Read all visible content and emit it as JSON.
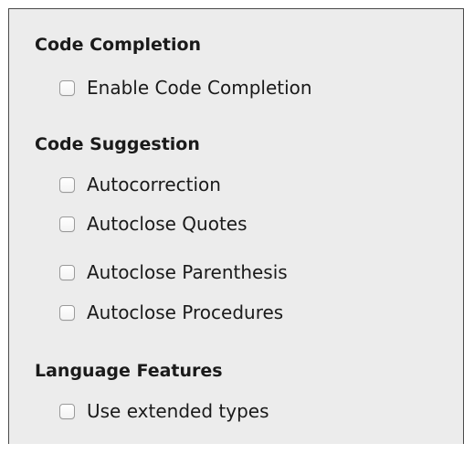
{
  "sections": [
    {
      "heading": "Code Completion",
      "options": [
        {
          "label": "Enable Code Completion",
          "checked": false
        }
      ]
    },
    {
      "heading": "Code Suggestion",
      "options": [
        {
          "label": "Autocorrection",
          "checked": false
        },
        {
          "label": "Autoclose Quotes",
          "checked": false
        },
        {
          "label": "Autoclose Parenthesis",
          "checked": false
        },
        {
          "label": "Autoclose Procedures",
          "checked": false
        }
      ]
    },
    {
      "heading": "Language Features",
      "options": [
        {
          "label": "Use extended types",
          "checked": false
        }
      ]
    }
  ],
  "colors": {
    "panel_background": "#ececec",
    "panel_border": "#4a4a4a",
    "text": "#1a1a1a",
    "checkbox_border": "#9a9a9a"
  }
}
